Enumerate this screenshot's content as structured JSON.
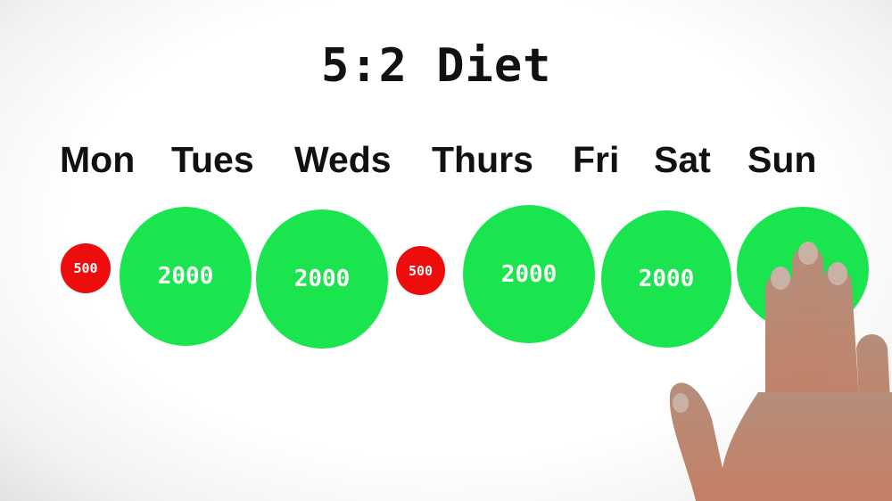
{
  "title": "5:2 Diet",
  "colors": {
    "full_day": "#1ae44e",
    "fast_day": "#ee0d0d",
    "text": "#111111"
  },
  "days": [
    {
      "label": "Mon",
      "calories": "500",
      "type": "fast"
    },
    {
      "label": "Tues",
      "calories": "2000",
      "type": "full"
    },
    {
      "label": "Weds",
      "calories": "2000",
      "type": "full"
    },
    {
      "label": "Thurs",
      "calories": "500",
      "type": "fast"
    },
    {
      "label": "Fri",
      "calories": "2000",
      "type": "full"
    },
    {
      "label": "Sat",
      "calories": "2000",
      "type": "full"
    },
    {
      "label": "Sun",
      "calories": "",
      "type": "full"
    }
  ]
}
